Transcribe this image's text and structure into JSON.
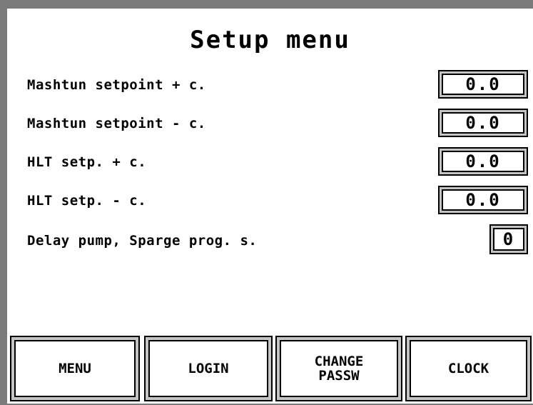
{
  "title": "Setup menu",
  "settings": [
    {
      "label": "Mashtun setpoint + c.",
      "value": "0.0"
    },
    {
      "label": "Mashtun setpoint - c.",
      "value": "0.0"
    },
    {
      "label": "HLT setp. + c.",
      "value": "0.0"
    },
    {
      "label": "HLT setp. - c.",
      "value": "0.0"
    },
    {
      "label": "Delay pump, Sparge prog. s.",
      "value": "0"
    }
  ],
  "buttons": {
    "menu": "MENU",
    "login": "LOGIN",
    "change_passw": "CHANGE\nPASSW",
    "clock": "CLOCK"
  }
}
